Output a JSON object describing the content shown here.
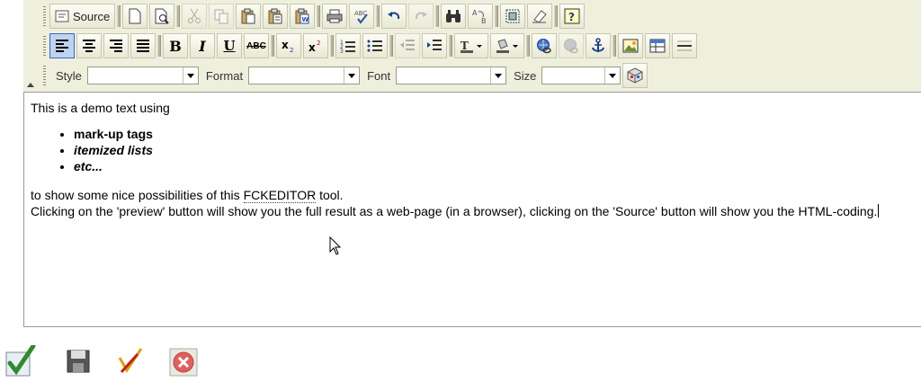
{
  "toolbar": {
    "source_label": "Source",
    "combos": {
      "style_label": "Style",
      "format_label": "Format",
      "font_label": "Font",
      "size_label": "Size",
      "style_value": "",
      "format_value": "",
      "font_value": "",
      "size_value": ""
    },
    "bold_label": "B",
    "italic_label": "I",
    "underline_label": "U",
    "strike_label": "ABC"
  },
  "editor": {
    "intro": "This is a demo text using",
    "list_items": [
      "mark-up tags",
      "itemized lists",
      "etc..."
    ],
    "outro_before": "to show some nice possibilities of this ",
    "outro_abbr": "FCKEDITOR",
    "outro_after": " tool.",
    "line2": "Clicking on the 'preview' button will show you the full result as a web-page (in a browser), clicking on the 'Source' button will show you the HTML-coding."
  },
  "bottom_buttons": [
    "accept-icon",
    "save-icon",
    "spellcheck-icon",
    "cancel-icon"
  ],
  "colors": {
    "toolbar_bg": "#efefde",
    "active_button": "#c1d2ee"
  }
}
